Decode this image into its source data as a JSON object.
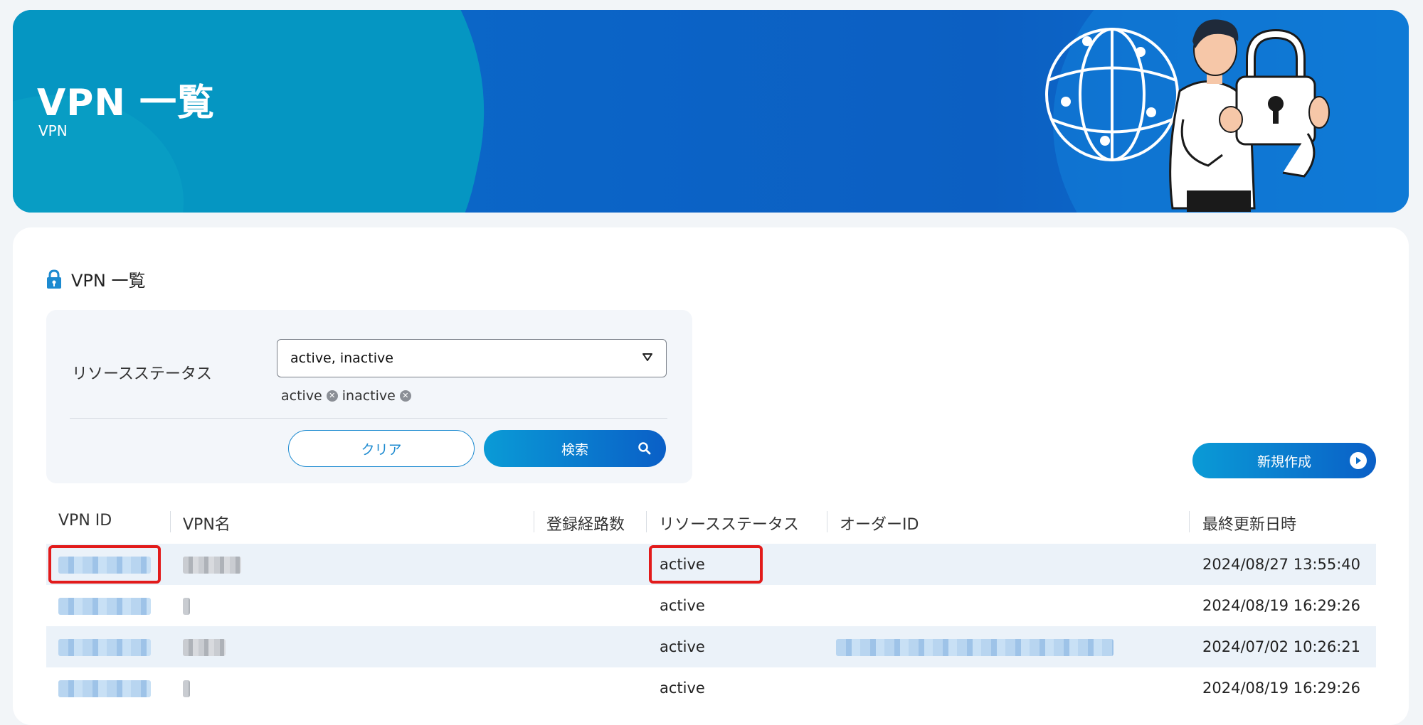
{
  "hero": {
    "title": "VPN 一覧",
    "subtitle": "VPN",
    "illustration": "person-with-padlock-and-globe"
  },
  "card": {
    "title": "VPN 一覧",
    "title_icon": "lock-icon"
  },
  "filter": {
    "status_label": "リソースステータス",
    "status_select_value": "active, inactive",
    "chips": [
      {
        "label": "active"
      },
      {
        "label": "inactive"
      }
    ],
    "clear_label": "クリア",
    "search_label": "検索"
  },
  "actions": {
    "new_label": "新規作成"
  },
  "table": {
    "headers": {
      "vpn_id": "VPN ID",
      "vpn_name": "VPN名",
      "route_count": "登録経路数",
      "resource_status": "リソースステータス",
      "order_id": "オーダーID",
      "updated_at": "最終更新日時"
    },
    "rows": [
      {
        "status": "active",
        "updated_at": "2024/08/27 13:55:40",
        "highlighted": true
      },
      {
        "status": "active",
        "updated_at": "2024/08/19 16:29:26",
        "highlighted": false
      },
      {
        "status": "active",
        "updated_at": "2024/07/02 10:26:21",
        "highlighted": false
      },
      {
        "status": "active",
        "updated_at": "2024/08/19 16:29:26",
        "highlighted": false
      }
    ]
  },
  "colors": {
    "accent": "#0a9bd6",
    "accent_dark": "#0a5fc7",
    "highlight": "#e21b1b",
    "row_alt": "#ebf2f9"
  }
}
